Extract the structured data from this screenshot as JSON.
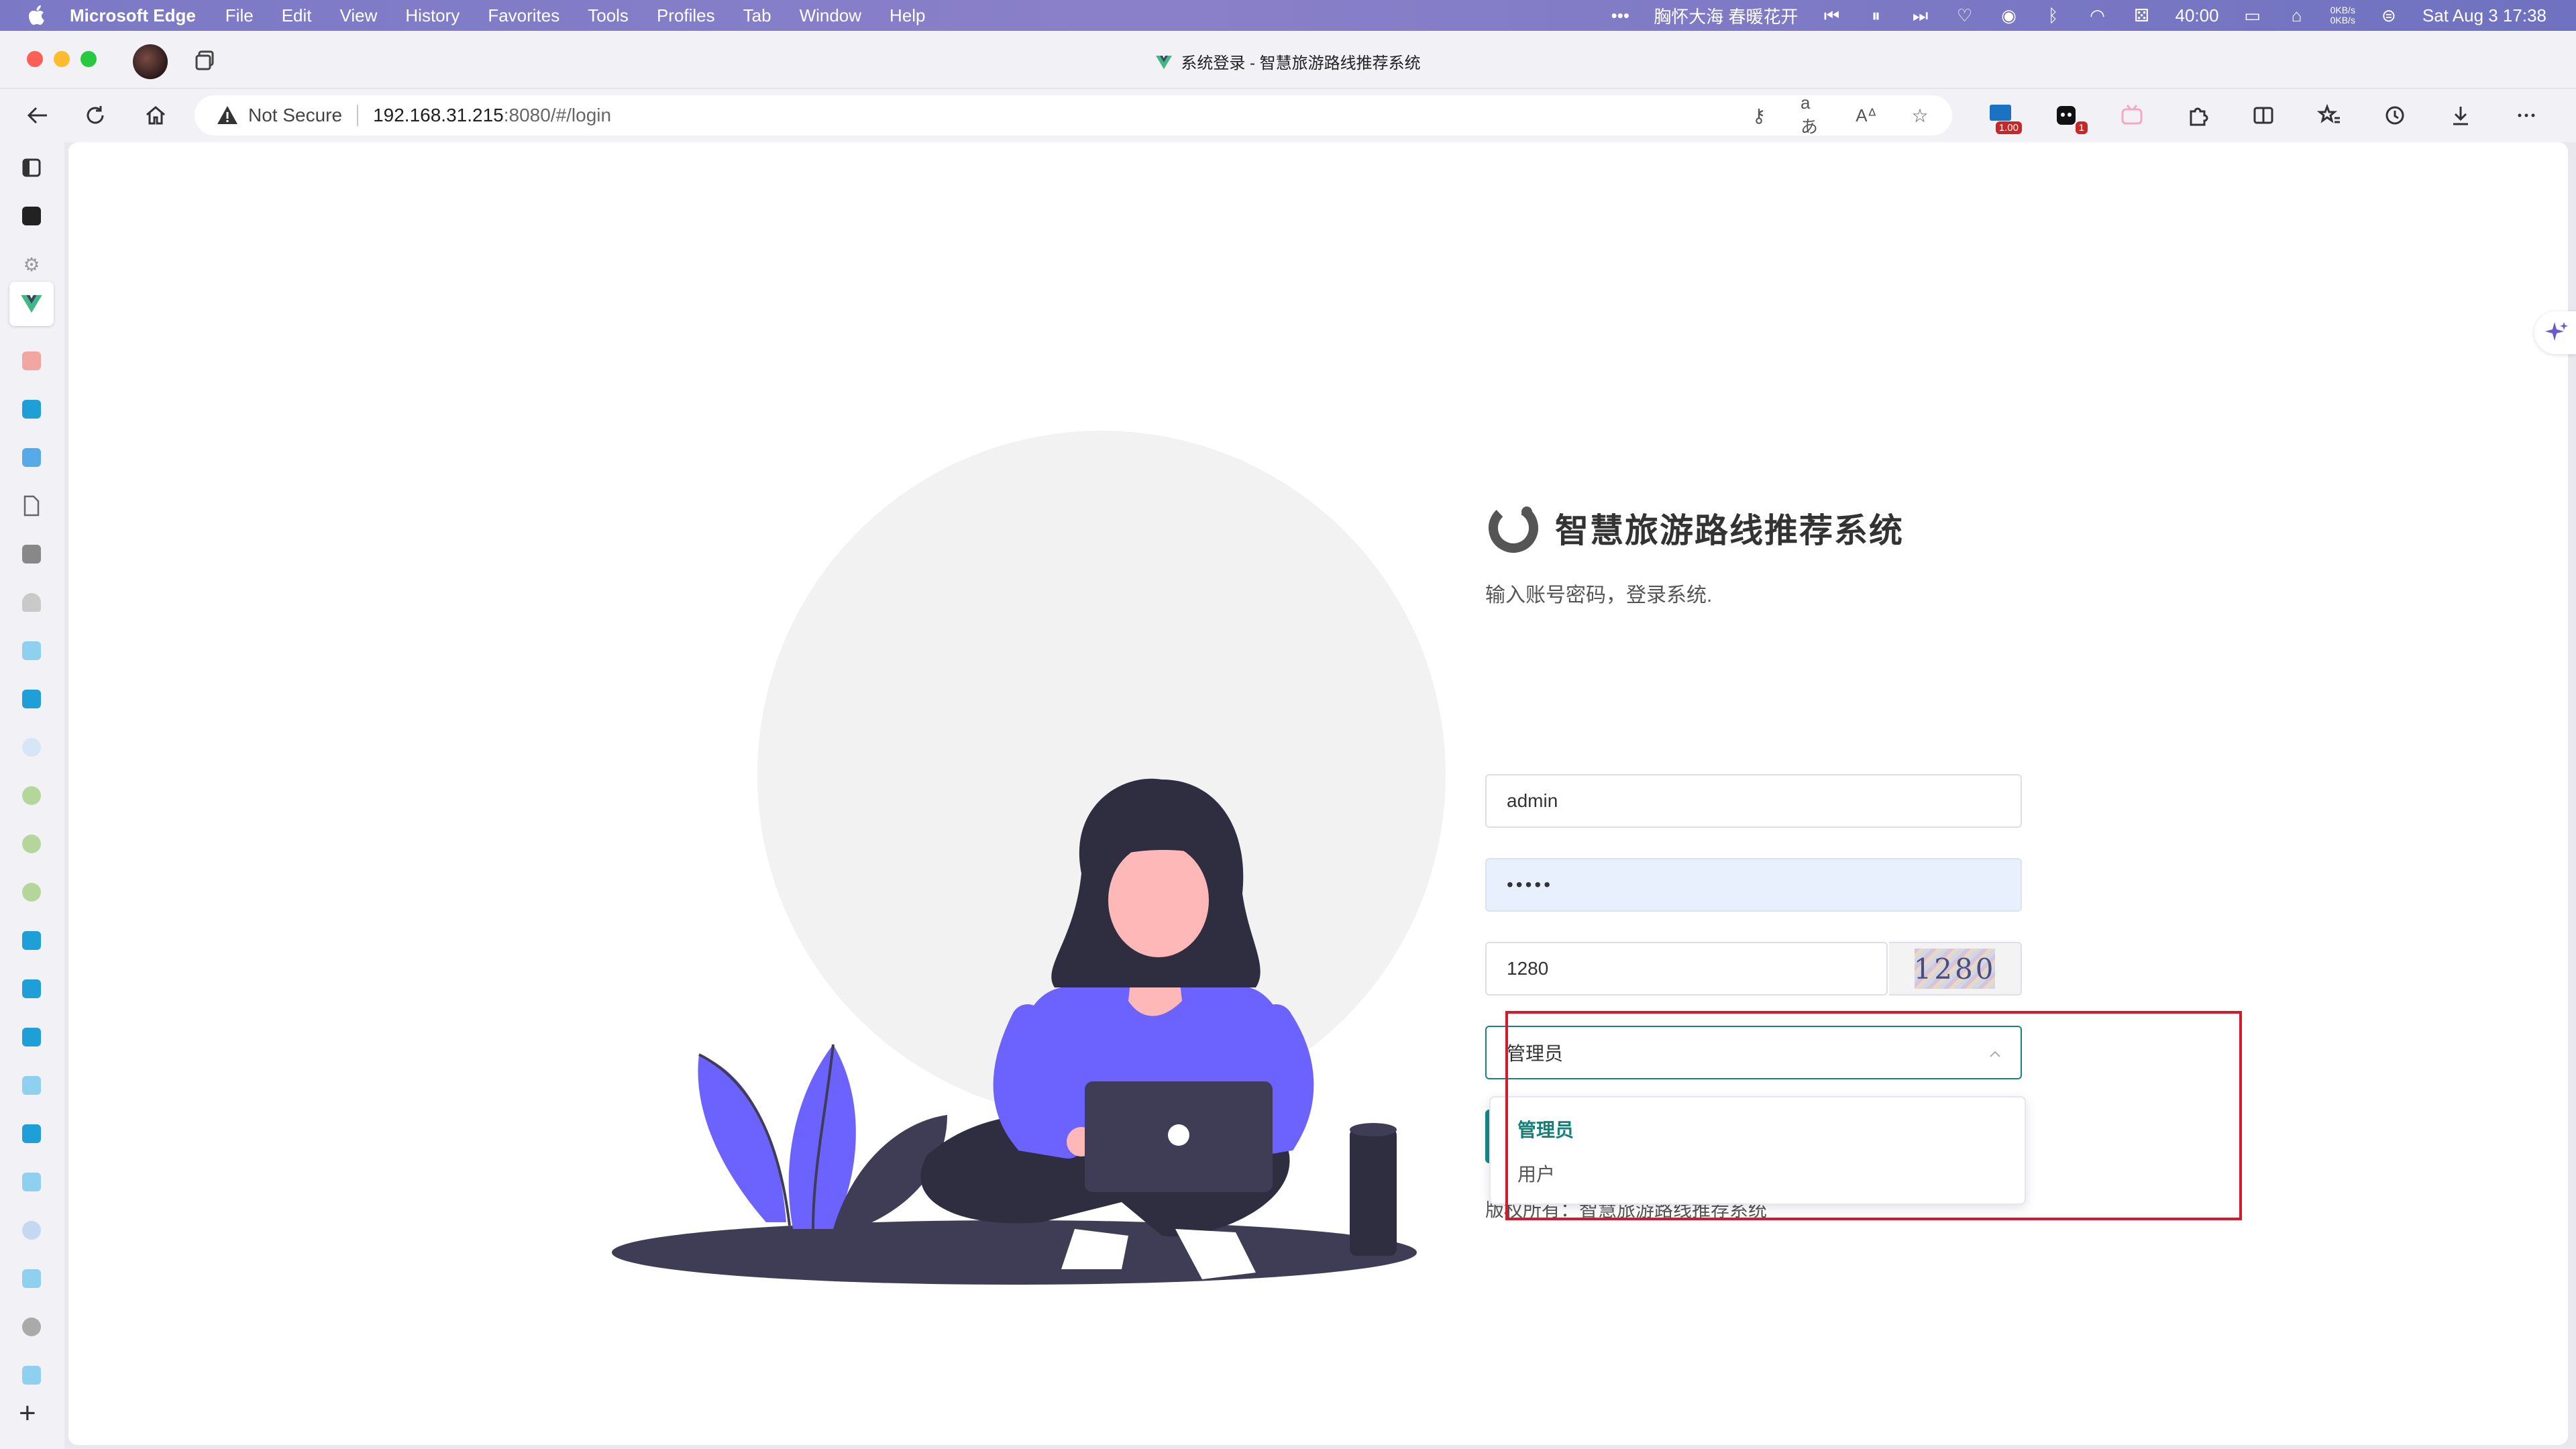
{
  "menubar": {
    "app_name": "Microsoft Edge",
    "items": [
      "File",
      "Edit",
      "View",
      "History",
      "Favorites",
      "Tools",
      "Profiles",
      "Tab",
      "Window",
      "Help"
    ],
    "now_playing": "胸怀大海 春暖花开",
    "battery_timer": "40:00",
    "net_up": "0KB/s",
    "net_down": "0KB/s",
    "datetime": "Sat Aug 3  17:38"
  },
  "window": {
    "title": "系统登录 - 智慧旅游路线推荐系统"
  },
  "addressbar": {
    "security_label": "Not Secure",
    "url_host": "192.168.31.215",
    "url_path": ":8080/#/login",
    "extension_badges": {
      "first": "1.00",
      "second": "1"
    }
  },
  "login": {
    "title": "智慧旅游路线推荐系统",
    "subtitle": "输入账号密码，登录系统.",
    "username_value": "admin",
    "password_value": "•••••",
    "captcha_value": "1280",
    "captcha_image_text": "1280",
    "role_value": "管理员",
    "copyright": "版权所有：智慧旅游路线推荐系统"
  },
  "dropdown": {
    "options": [
      "管理员",
      "用户"
    ]
  },
  "colors": {
    "accent": "#14807c",
    "highlight": "#d8192b",
    "illustration_purple": "#6c63ff"
  }
}
